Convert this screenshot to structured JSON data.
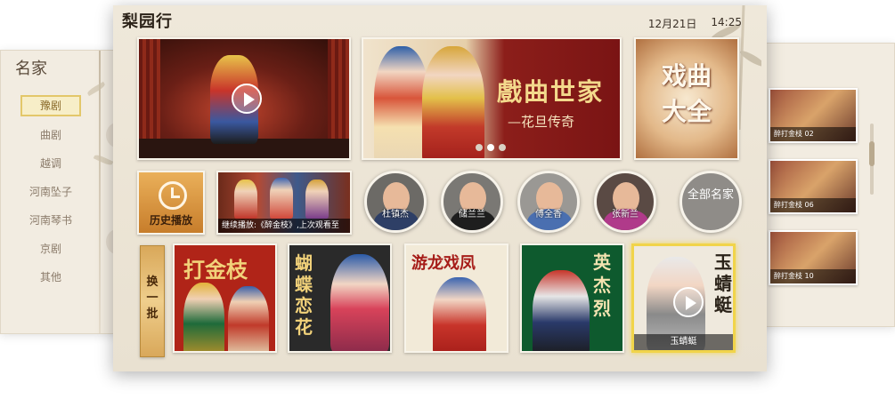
{
  "left_panel": {
    "title": "名家",
    "categories": [
      "豫剧",
      "曲剧",
      "越调",
      "河南坠子",
      "河南琴书",
      "京剧",
      "其他"
    ],
    "active_index": 0
  },
  "right_panel": {
    "thumbs": [
      "醉打金枝 02",
      "醉打金枝 06",
      "醉打金枝 10"
    ]
  },
  "header": {
    "app_title": "梨园行",
    "date": "12月21日",
    "time": "14:25"
  },
  "hero": {
    "banner_title": "戲曲世家",
    "banner_subtitle": "—花旦传奇",
    "collection_title_line1": "戏曲",
    "collection_title_line2": "大全"
  },
  "history": {
    "label": "历史播放",
    "continue_caption": "继续播放:《醉金枝》,上次观看至"
  },
  "artists": [
    {
      "name": "杜镇杰",
      "suit": "#2e3f66"
    },
    {
      "name": "储兰兰",
      "suit": "#1e1e1e"
    },
    {
      "name": "傅全香",
      "suit": "#4a6fb0"
    },
    {
      "name": "张新兰",
      "suit": "#b03a8a"
    }
  ],
  "all_artists_label": "全部名家",
  "swap_label": "换一批",
  "dramas": [
    {
      "title": "打金枝",
      "bg": "#b02418"
    },
    {
      "title": "蝴蝶恋花",
      "bg": "#2a2a2a"
    },
    {
      "title": "游龙戏凤",
      "bg": "#f2ead8"
    },
    {
      "title": "英杰烈",
      "bg": "#0e5a2e"
    },
    {
      "title": "玉蜻蜓",
      "bg": "#efe9dd",
      "caption": "玉蜻蜓"
    }
  ]
}
